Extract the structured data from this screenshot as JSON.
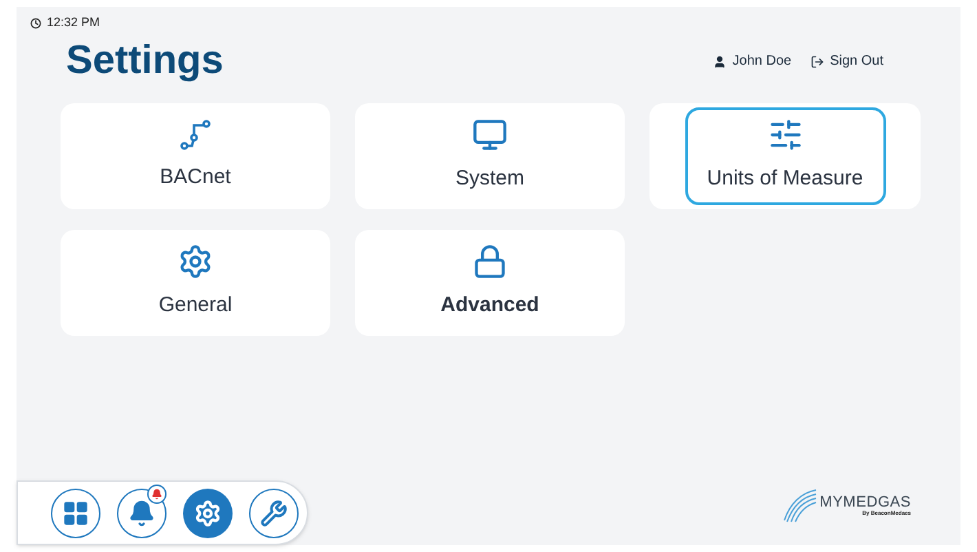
{
  "status_bar": {
    "time": "12:32 PM"
  },
  "header": {
    "title": "Settings",
    "user": "John Doe",
    "sign_out": "Sign Out"
  },
  "cards": [
    {
      "label": "BACnet",
      "kind": "nodes",
      "selected": false,
      "bold": false
    },
    {
      "label": "System",
      "kind": "monitor",
      "selected": false,
      "bold": false
    },
    {
      "label": "Units of Measure",
      "kind": "sliders",
      "selected": true,
      "bold": false
    },
    {
      "label": "General",
      "kind": "gear",
      "selected": false,
      "bold": false
    },
    {
      "label": "Advanced",
      "kind": "lock",
      "selected": false,
      "bold": true
    }
  ],
  "nav": [
    {
      "kind": "grid",
      "selected": false,
      "badge": false
    },
    {
      "kind": "bell",
      "selected": false,
      "badge": true
    },
    {
      "kind": "gear",
      "selected": true,
      "badge": false
    },
    {
      "kind": "tools",
      "selected": false,
      "badge": false
    }
  ],
  "logo": {
    "name": "MYMEDGAS",
    "tagline": "By BeaconMedaes"
  }
}
